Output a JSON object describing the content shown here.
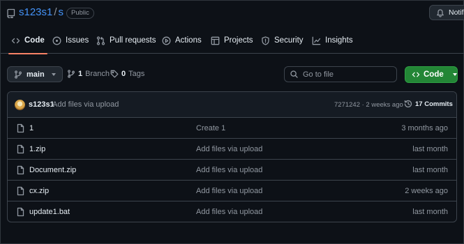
{
  "repo": {
    "owner": "s123s1",
    "separator": "/",
    "name": "s",
    "visibility": "Public",
    "notifications_label": "Notifi"
  },
  "tabs": [
    {
      "label": "Code",
      "icon": "code-icon"
    },
    {
      "label": "Issues",
      "icon": "issue-icon"
    },
    {
      "label": "Pull requests",
      "icon": "pull-request-icon"
    },
    {
      "label": "Actions",
      "icon": "play-icon"
    },
    {
      "label": "Projects",
      "icon": "table-icon"
    },
    {
      "label": "Security",
      "icon": "shield-icon"
    },
    {
      "label": "Insights",
      "icon": "graph-icon"
    }
  ],
  "toolbar": {
    "branch": "main",
    "branch_count": "1",
    "branch_label": "Branch",
    "tag_count": "0",
    "tag_label": "Tags",
    "search_placeholder": "Go to file",
    "code_button": "Code"
  },
  "latest_commit": {
    "user": "s123s1",
    "message": "Add files via upload",
    "meta": "7271242 · 2 weeks ago",
    "commits_label": "17 Commits"
  },
  "files": [
    {
      "name": "1",
      "message": "Create 1",
      "age": "3 months ago"
    },
    {
      "name": "1.zip",
      "message": "Add files via upload",
      "age": "last month"
    },
    {
      "name": "Document.zip",
      "message": "Add files via upload",
      "age": "last month"
    },
    {
      "name": "cx.zip",
      "message": "Add files via upload",
      "age": "2 weeks ago"
    },
    {
      "name": "update1.bat",
      "message": "Add files via upload",
      "age": "last month"
    }
  ],
  "colors": {
    "background": "#0d1117",
    "link": "#4493f8",
    "active_tab_underline": "#f78166",
    "primary_button": "#238636"
  }
}
